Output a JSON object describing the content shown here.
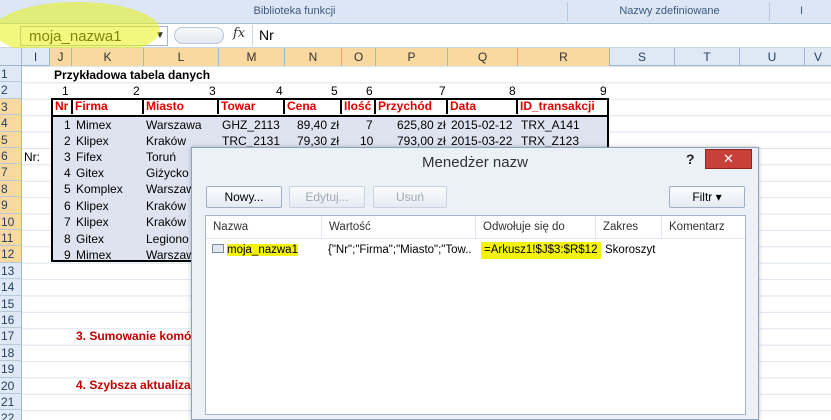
{
  "ribbon": {
    "groups": [
      {
        "label": "Biblioteka funkcji"
      },
      {
        "label": "Nazwy zdefiniowane"
      },
      {
        "label": "I"
      }
    ]
  },
  "formula_bar": {
    "name_box": "moja_nazwa1",
    "fx": "fx",
    "formula": "Nr"
  },
  "columns": [
    "I",
    "J",
    "K",
    "L",
    "M",
    "N",
    "O",
    "P",
    "Q",
    "R",
    "S",
    "T",
    "U",
    "V"
  ],
  "rows": [
    "1",
    "2",
    "3",
    "4",
    "5",
    "6",
    "7",
    "8",
    "9",
    "10",
    "11",
    "12",
    "13",
    "14",
    "15",
    "16",
    "17",
    "18",
    "19",
    "20",
    "21",
    "22"
  ],
  "sheet": {
    "title": "Przykładowa tabela danych",
    "numbers": [
      "1",
      "2",
      "3",
      "4",
      "5",
      "6",
      "7",
      "8",
      "9"
    ],
    "headers": [
      "Nr",
      "Firma",
      "Miasto",
      "Towar",
      "Cena",
      "Ilość",
      "Przychód",
      "Data",
      "ID_transakcji"
    ],
    "rows": [
      [
        "1",
        "Mimex",
        "Warszawa",
        "GHZ_2113",
        "89,40 zł",
        "7",
        "625,80 zł",
        "2015-02-12",
        "TRX_A141"
      ],
      [
        "2",
        "Klipex",
        "Kraków",
        "TRC_2131",
        "79,30 zł",
        "10",
        "793,00 zł",
        "2015-03-22",
        "TRX_Z123"
      ],
      [
        "3",
        "Fifex",
        "Toruń",
        "",
        "",
        "",
        "",
        "",
        ""
      ],
      [
        "4",
        "Gitex",
        "Giżycko",
        "",
        "",
        "",
        "",
        "",
        ""
      ],
      [
        "5",
        "Komplex",
        "Warszaw",
        "",
        "",
        "",
        "",
        "",
        ""
      ],
      [
        "6",
        "Klipex",
        "Kraków",
        "",
        "",
        "",
        "",
        "",
        ""
      ],
      [
        "7",
        "Klipex",
        "Kraków",
        "",
        "",
        "",
        "",
        "",
        ""
      ],
      [
        "8",
        "Gitex",
        "Legiono",
        "",
        "",
        "",
        "",
        "",
        ""
      ],
      [
        "9",
        "Mimex",
        "Warszaw",
        "",
        "",
        "",
        "",
        "",
        ""
      ]
    ],
    "nr_label": "Nr:",
    "section3": "3. Sumowanie komó",
    "section4": "4. Szybsza aktualizac"
  },
  "dialog": {
    "title": "Menedżer nazw",
    "help": "?",
    "close": "✕",
    "buttons": {
      "new": "Nowy...",
      "edit": "Edytuj...",
      "delete": "Usuń",
      "filter": "Filtr ▾"
    },
    "columns": [
      "Nazwa",
      "Wartość",
      "Odwołuje się do",
      "Zakres",
      "Komentarz"
    ],
    "entries": [
      {
        "name": "moja_nazwa1",
        "value": "{\"Nr\";\"Firma\";\"Miasto\";\"Tow...",
        "refers_to": "=Arkusz1!$J$3:$R$12",
        "scope": "Skoroszyt",
        "comment": ""
      }
    ]
  },
  "colors": {
    "header_red": "#e00000",
    "section_red": "#c00000",
    "highlight_yellow": "#f2f20a",
    "close_red": "#c7403a"
  }
}
